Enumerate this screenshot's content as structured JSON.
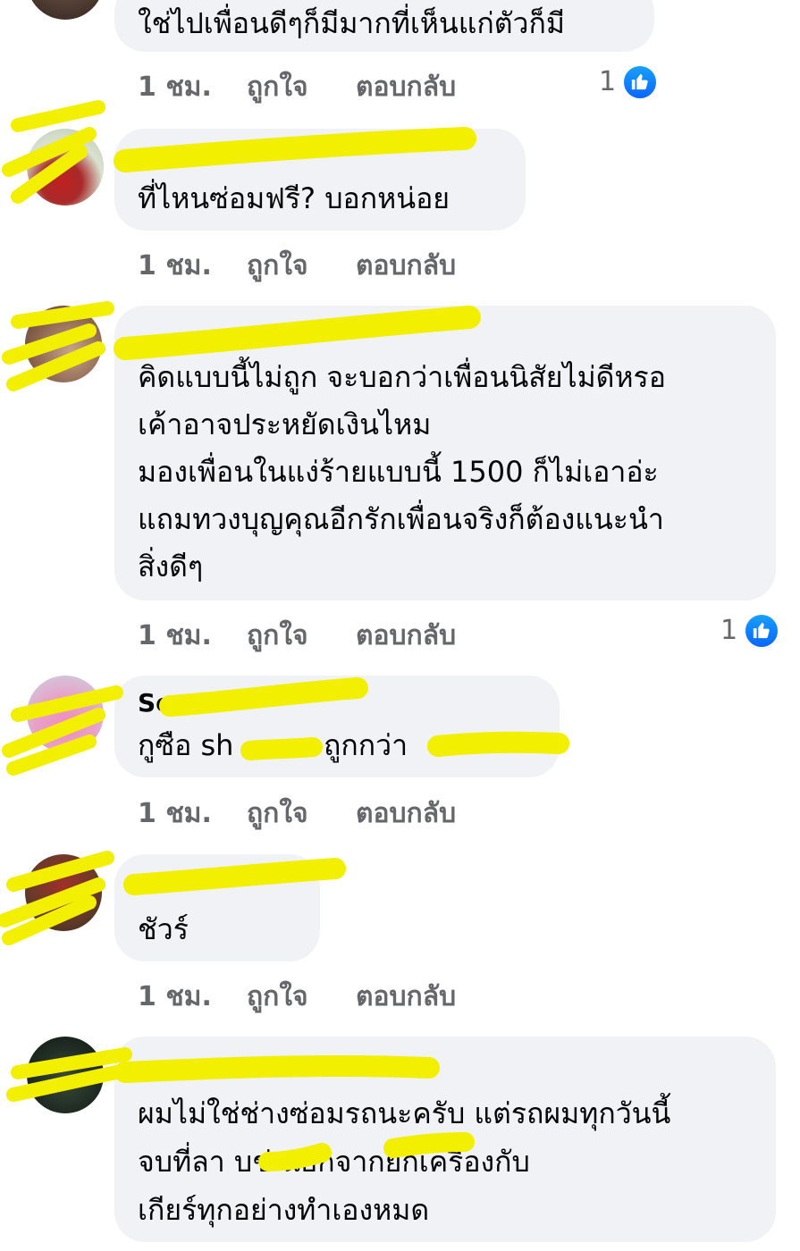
{
  "comments": [
    {
      "name": "",
      "lines": [
        "ใช่ไปเพื่อนดีๆก็มีมากที่เห็นแก่ตัวก็มี"
      ],
      "time": "1 ชม.",
      "like": "ถูกใจ",
      "reply": "ตอบกลับ",
      "reactions": "1",
      "reaction_icon": "like-icon"
    },
    {
      "name": "",
      "lines": [
        "ที่ไหนซ่อมฟรี? บอกหน่อย"
      ],
      "time": "1 ชม.",
      "like": "ถูกใจ",
      "reply": "ตอบกลับ"
    },
    {
      "name": "",
      "lines": [
        "คิดแบบนี้ไม่ถูก จะบอกว่าเพื่อนนิสัยไม่ดีหรอ",
        "เค้าอาจประหยัดเงินไหม",
        "มองเพื่อนในแง่ร้ายแบบนี้ 1500 ก็ไม่เอาอ่ะ",
        "แถมทวงบุญคุณอีกรักเพื่อนจริงก็ต้องแนะนำ",
        "สิ่งดีๆ"
      ],
      "time": "1 ชม.",
      "like": "ถูกใจ",
      "reply": "ตอบกลับ",
      "reactions": "1",
      "reaction_icon": "like-icon"
    },
    {
      "name": "Sor",
      "lines": [
        "กูซือ sh",
        "ถูกกว่า"
      ],
      "time": "1 ชม.",
      "like": "ถูกใจ",
      "reply": "ตอบกลับ"
    },
    {
      "name": "",
      "lines": [
        "ชัวร์"
      ],
      "time": "1 ชม.",
      "like": "ถูกใจ",
      "reply": "ตอบกลับ"
    },
    {
      "name": "",
      "lines": [
        "ผมไม่ใช่ช่างซ่อมรถนะครับ  แต่รถผมทุกวันนี้",
        "จบที่ลา          บช่         นอกจากยกเครื่องกับ",
        "เกียร์ทุกอย่างทำเองหมด"
      ]
    }
  ],
  "colors": {
    "bubble": "#f0f2f5",
    "meta": "#65676b",
    "like_blue": "#0866ff",
    "redaction": "#f2ef00"
  }
}
